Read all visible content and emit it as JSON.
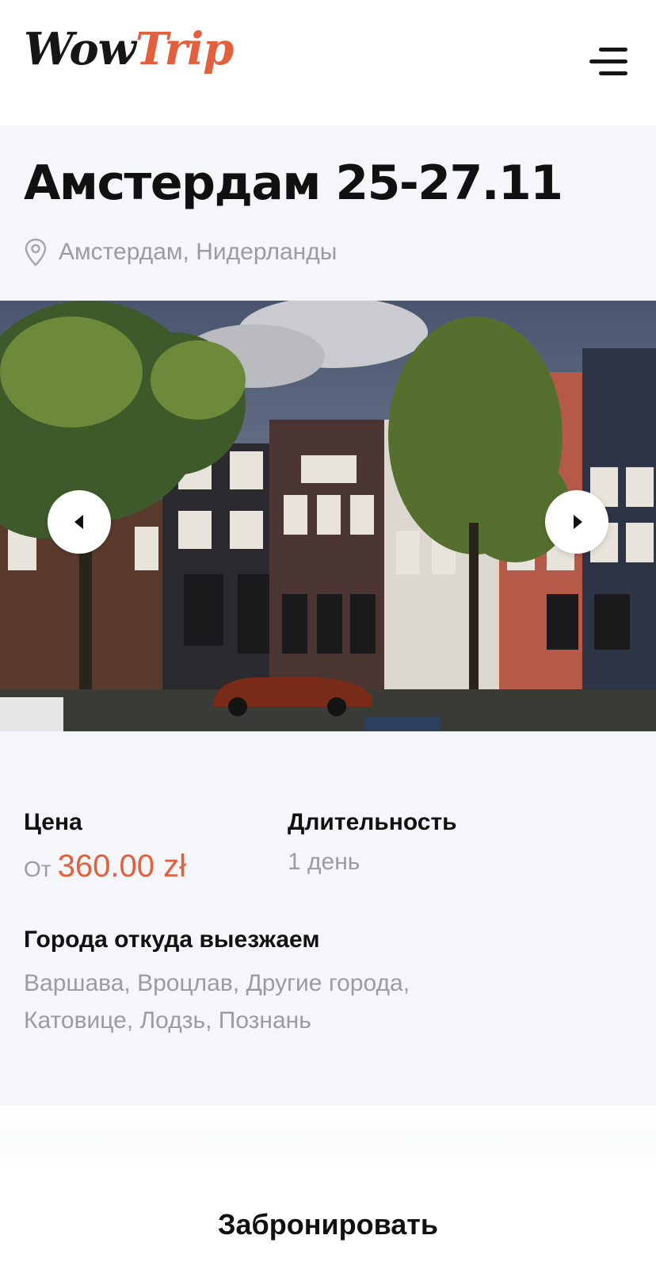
{
  "header": {
    "logo": {
      "part1": "Wow",
      "part2": "Trip"
    },
    "menu_icon": "hamburger-menu-icon"
  },
  "tour": {
    "title": "Амстердам 25-27.11",
    "location": "Амстердам, Нидерланды",
    "location_icon": "map-pin-icon"
  },
  "gallery": {
    "prev_icon": "chevron-left-icon",
    "next_icon": "chevron-right-icon"
  },
  "info": {
    "price_label": "Цена",
    "price_prefix": "От",
    "price_value": "360.00 zł",
    "duration_label": "Длительность",
    "duration_value": "1 день",
    "cities_label": "Города откуда выезжаем",
    "cities_value": "Варшава, Вроцлав, Другие города, Катовице, Лодзь, Познань"
  },
  "footer": {
    "book_label": "Забронировать"
  },
  "colors": {
    "accent": "#e2603e",
    "muted_text": "#9a9ca3",
    "section_bg": "#f5f6fa"
  }
}
